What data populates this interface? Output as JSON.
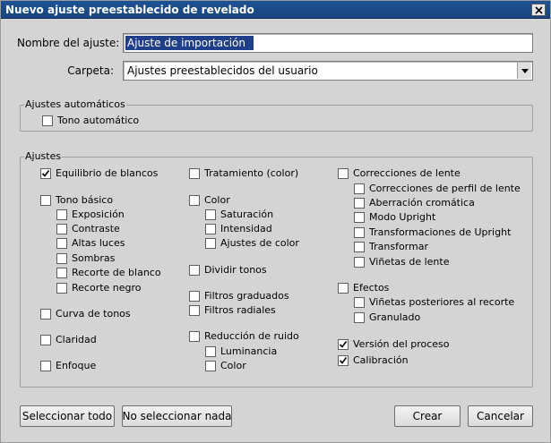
{
  "dialog": {
    "title": "Nuevo ajuste preestablecido de revelado",
    "name_label": "Nombre del ajuste:",
    "name_value": "Ajuste de importación",
    "folder_label": "Carpeta:",
    "folder_value": "Ajustes preestablecidos del usuario"
  },
  "auto_group": {
    "legend": "Ajustes automáticos",
    "auto_tone": {
      "label": "Tono automático",
      "checked": false
    }
  },
  "settings_group": {
    "legend": "Ajustes",
    "col1": [
      {
        "label": "Equilibrio de blancos",
        "checked": true
      },
      {
        "label": "Tono básico",
        "checked": false
      },
      {
        "label": "Exposición",
        "checked": false
      },
      {
        "label": "Contraste",
        "checked": false
      },
      {
        "label": "Altas luces",
        "checked": false
      },
      {
        "label": "Sombras",
        "checked": false
      },
      {
        "label": "Recorte de blanco",
        "checked": false
      },
      {
        "label": "Recorte negro",
        "checked": false
      },
      {
        "label": "Curva de tonos",
        "checked": false
      },
      {
        "label": "Claridad",
        "checked": false
      },
      {
        "label": "Enfoque",
        "checked": false
      }
    ],
    "col2": [
      {
        "label": "Tratamiento (color)",
        "checked": false
      },
      {
        "label": "Color",
        "checked": false
      },
      {
        "label": "Saturación",
        "checked": false
      },
      {
        "label": "Intensidad",
        "checked": false
      },
      {
        "label": "Ajustes de color",
        "checked": false
      },
      {
        "label": "Dividir tonos",
        "checked": false
      },
      {
        "label": "Filtros graduados",
        "checked": false
      },
      {
        "label": "Filtros radiales",
        "checked": false
      },
      {
        "label": "Reducción de ruido",
        "checked": false
      },
      {
        "label": "Luminancia",
        "checked": false
      },
      {
        "label": "Color",
        "checked": false
      }
    ],
    "col3": [
      {
        "label": "Correcciones de lente",
        "checked": false
      },
      {
        "label": "Correcciones de perfil de lente",
        "checked": false
      },
      {
        "label": "Aberración cromática",
        "checked": false
      },
      {
        "label": "Modo Upright",
        "checked": false
      },
      {
        "label": "Transformaciones de Upright",
        "checked": false
      },
      {
        "label": "Transformar",
        "checked": false
      },
      {
        "label": "Viñetas de lente",
        "checked": false
      },
      {
        "label": "Efectos",
        "checked": false
      },
      {
        "label": "Viñetas posteriores al recorte",
        "checked": false
      },
      {
        "label": "Granulado",
        "checked": false
      },
      {
        "label": "Versión del proceso",
        "checked": true
      },
      {
        "label": "Calibración",
        "checked": true
      }
    ]
  },
  "buttons": {
    "select_all": "Seleccionar todo",
    "select_none": "No seleccionar nada",
    "create": "Crear",
    "cancel": "Cancelar"
  }
}
